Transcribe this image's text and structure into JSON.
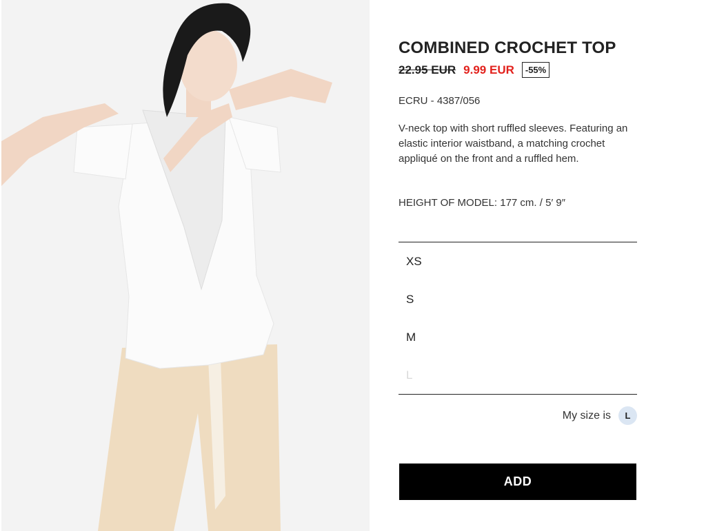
{
  "product": {
    "title": "COMBINED CROCHET TOP",
    "old_price": "22.95 EUR",
    "new_price": "9.99 EUR",
    "discount": "-55%",
    "reference": "ECRU - 4387/056",
    "description": "V-neck top with short ruffled sleeves. Featuring an elastic interior waistband, a matching crochet appliqué on the front and a ruffled hem.",
    "model_height": "HEIGHT OF MODEL: 177 cm. / 5′ 9″",
    "image_icon": "model-photo"
  },
  "sizes": [
    {
      "label": "XS",
      "available": true
    },
    {
      "label": "S",
      "available": true
    },
    {
      "label": "M",
      "available": true
    },
    {
      "label": "L",
      "available": false
    }
  ],
  "my_size": {
    "label": "My size is",
    "value": "L"
  },
  "add_button": {
    "label": "ADD"
  },
  "colors": {
    "sale_red": "#e2211c",
    "button_black": "#000000",
    "badge_blue": "#dbe6f3",
    "unavailable_gray": "#d9d9d9"
  }
}
